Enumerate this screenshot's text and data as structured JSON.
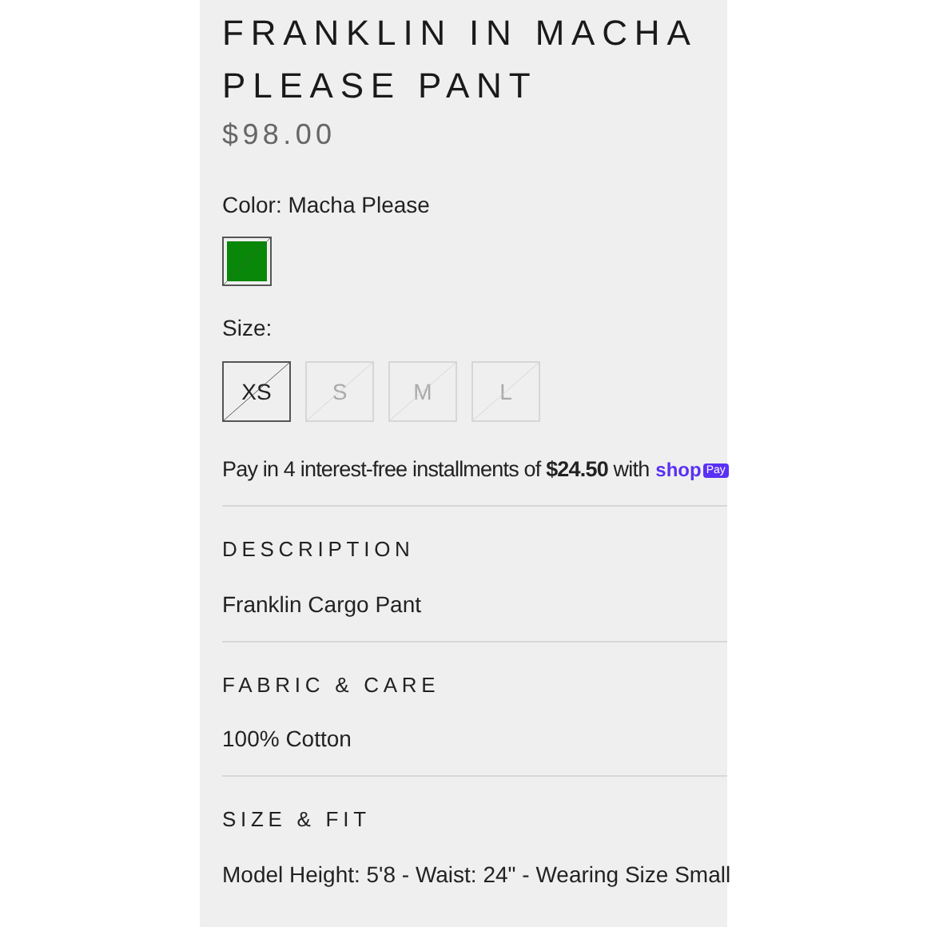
{
  "product": {
    "title": "FRANKLIN IN MACHA PLEASE PANT",
    "price": "$98.00"
  },
  "color": {
    "label": "Color: Macha Please",
    "swatches": [
      {
        "color": "#098709",
        "selected": true,
        "available": false
      }
    ]
  },
  "size": {
    "label": "Size:",
    "options": [
      {
        "label": "XS",
        "selected": true,
        "available": false
      },
      {
        "label": "S",
        "selected": false,
        "available": false
      },
      {
        "label": "M",
        "selected": false,
        "available": false
      },
      {
        "label": "L",
        "selected": false,
        "available": false
      }
    ]
  },
  "installments": {
    "text": "Pay in 4 interest-free installments of **$24.50** with",
    "brand": "shop",
    "badge": "Pay"
  },
  "sections": [
    {
      "heading": "DESCRIPTION",
      "body": "Franklin Cargo Pant"
    },
    {
      "heading": "FABRIC & CARE",
      "body": "100% Cotton"
    },
    {
      "heading": "SIZE & FIT",
      "body": "Model Height: 5'8 - Waist: 24\" - Wearing Size Small"
    }
  ]
}
